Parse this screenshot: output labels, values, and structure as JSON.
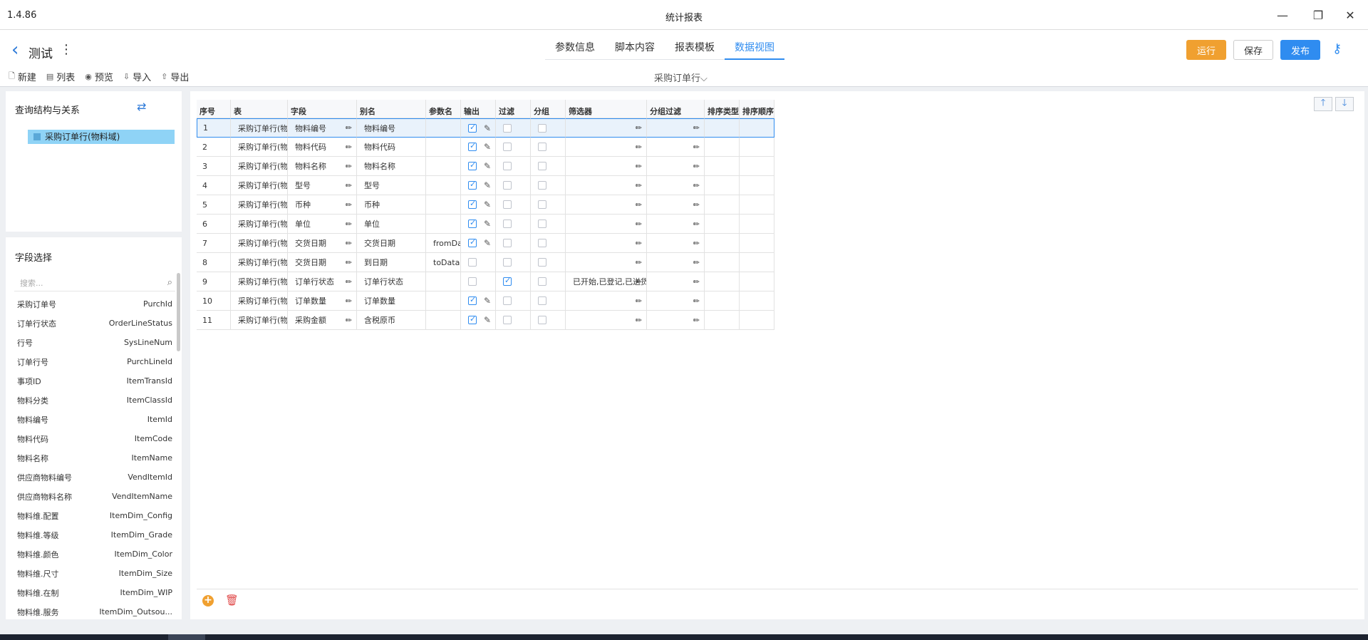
{
  "window": {
    "version": "1.4.86",
    "title": "统计报表",
    "controls": {
      "minimize": "—",
      "restore": "❐",
      "close": "✕"
    }
  },
  "header": {
    "back_glyph": "‹",
    "doc_title": "测试",
    "more_glyph": "⋮",
    "tabs": [
      {
        "label": "参数信息"
      },
      {
        "label": "脚本内容"
      },
      {
        "label": "报表模板"
      },
      {
        "label": "数据视图"
      }
    ],
    "active_tab": "数据视图",
    "buttons": {
      "run": "运行",
      "save": "保存",
      "publish": "发布"
    },
    "key_glyph": "⚷"
  },
  "actions": [
    {
      "label": "新建",
      "icon": "new-doc-icon",
      "glyph": "🗋"
    },
    {
      "label": "列表",
      "icon": "list-icon",
      "glyph": "▤"
    },
    {
      "label": "预览",
      "icon": "eye-icon",
      "glyph": "◉"
    },
    {
      "label": "导入",
      "icon": "import-icon",
      "glyph": "⇩"
    },
    {
      "label": "导出",
      "icon": "export-icon",
      "glyph": "⇧"
    }
  ],
  "dataset_selector": "采购订单行⌵",
  "query_panel": {
    "title": "查询结构与关系",
    "swap_glyph": "⇄",
    "tree_node": "采购订单行(物料域)"
  },
  "fields_panel": {
    "title": "字段选择",
    "search_placeholder": "搜索...",
    "search_glyph": "⌕",
    "items": [
      {
        "name": "采购订单号",
        "code": "PurchId"
      },
      {
        "name": "订单行状态",
        "code": "OrderLineStatus"
      },
      {
        "name": "行号",
        "code": "SysLineNum"
      },
      {
        "name": "订单行号",
        "code": "PurchLineId"
      },
      {
        "name": "事项ID",
        "code": "ItemTransId"
      },
      {
        "name": "物料分类",
        "code": "ItemClassId"
      },
      {
        "name": "物料编号",
        "code": "ItemId"
      },
      {
        "name": "物料代码",
        "code": "ItemCode"
      },
      {
        "name": "物料名称",
        "code": "ItemName"
      },
      {
        "name": "供应商物料编号",
        "code": "VendItemId"
      },
      {
        "name": "供应商物料名称",
        "code": "VendItemName"
      },
      {
        "name": "物料维.配置",
        "code": "ItemDim_Config"
      },
      {
        "name": "物料维.等级",
        "code": "ItemDim_Grade"
      },
      {
        "name": "物料维.颜色",
        "code": "ItemDim_Color"
      },
      {
        "name": "物料维.尺寸",
        "code": "ItemDim_Size"
      },
      {
        "name": "物料维.在制",
        "code": "ItemDim_WIP"
      },
      {
        "name": "物料维.服务",
        "code": "ItemDim_Outsou..."
      }
    ]
  },
  "grid": {
    "headers": [
      "序号",
      "表",
      "字段",
      "别名",
      "参数名",
      "输出",
      "过滤",
      "分组",
      "筛选器",
      "分组过滤",
      "排序类型",
      "排序顺序"
    ],
    "rows": [
      {
        "no": "1",
        "table": "采购订单行(物料域)",
        "field": "物料编号",
        "alias": "物料编号",
        "param": "",
        "output": true,
        "filter": false,
        "group": false,
        "filter_value": ""
      },
      {
        "no": "2",
        "table": "采购订单行(物料域)",
        "field": "物料代码",
        "alias": "物料代码",
        "param": "",
        "output": true,
        "filter": false,
        "group": false,
        "filter_value": ""
      },
      {
        "no": "3",
        "table": "采购订单行(物料域)",
        "field": "物料名称",
        "alias": "物料名称",
        "param": "",
        "output": true,
        "filter": false,
        "group": false,
        "filter_value": ""
      },
      {
        "no": "4",
        "table": "采购订单行(物料域)",
        "field": "型号",
        "alias": "型号",
        "param": "",
        "output": true,
        "filter": false,
        "group": false,
        "filter_value": ""
      },
      {
        "no": "5",
        "table": "采购订单行(物料域)",
        "field": "币种",
        "alias": "币种",
        "param": "",
        "output": true,
        "filter": false,
        "group": false,
        "filter_value": ""
      },
      {
        "no": "6",
        "table": "采购订单行(物料域)",
        "field": "单位",
        "alias": "单位",
        "param": "",
        "output": true,
        "filter": false,
        "group": false,
        "filter_value": ""
      },
      {
        "no": "7",
        "table": "采购订单行(物料域)",
        "field": "交货日期",
        "alias": "交货日期",
        "param": "fromData",
        "output": true,
        "filter": false,
        "group": false,
        "filter_value": ""
      },
      {
        "no": "8",
        "table": "采购订单行(物料域)",
        "field": "交货日期",
        "alias": "到日期",
        "param": "toData",
        "output": false,
        "filter": false,
        "group": false,
        "filter_value": ""
      },
      {
        "no": "9",
        "table": "采购订单行(物料域)",
        "field": "订单行状态",
        "alias": "订单行状态",
        "param": "",
        "output": false,
        "filter": true,
        "group": false,
        "filter_value": "已开始,已登记,已送货"
      },
      {
        "no": "10",
        "table": "采购订单行(物料域)",
        "field": "订单数量",
        "alias": "订单数量",
        "param": "",
        "output": true,
        "filter": false,
        "group": false,
        "filter_value": ""
      },
      {
        "no": "11",
        "table": "采购订单行(物料域)",
        "field": "采购金额",
        "alias": "含税原币",
        "param": "",
        "output": true,
        "filter": false,
        "group": false,
        "filter_value": ""
      }
    ],
    "selected_row": "1",
    "move_up_glyph": "🡑",
    "move_down_glyph": "🡓",
    "add_glyph": "+",
    "delete_glyph": "🗑",
    "edit_glyph": "✎",
    "pencil_glyph": "✏"
  },
  "colors": {
    "accent": "#2f8cf0",
    "run": "#f0a030",
    "delete": "#e04848",
    "selected_node": "#8fd3f6"
  }
}
